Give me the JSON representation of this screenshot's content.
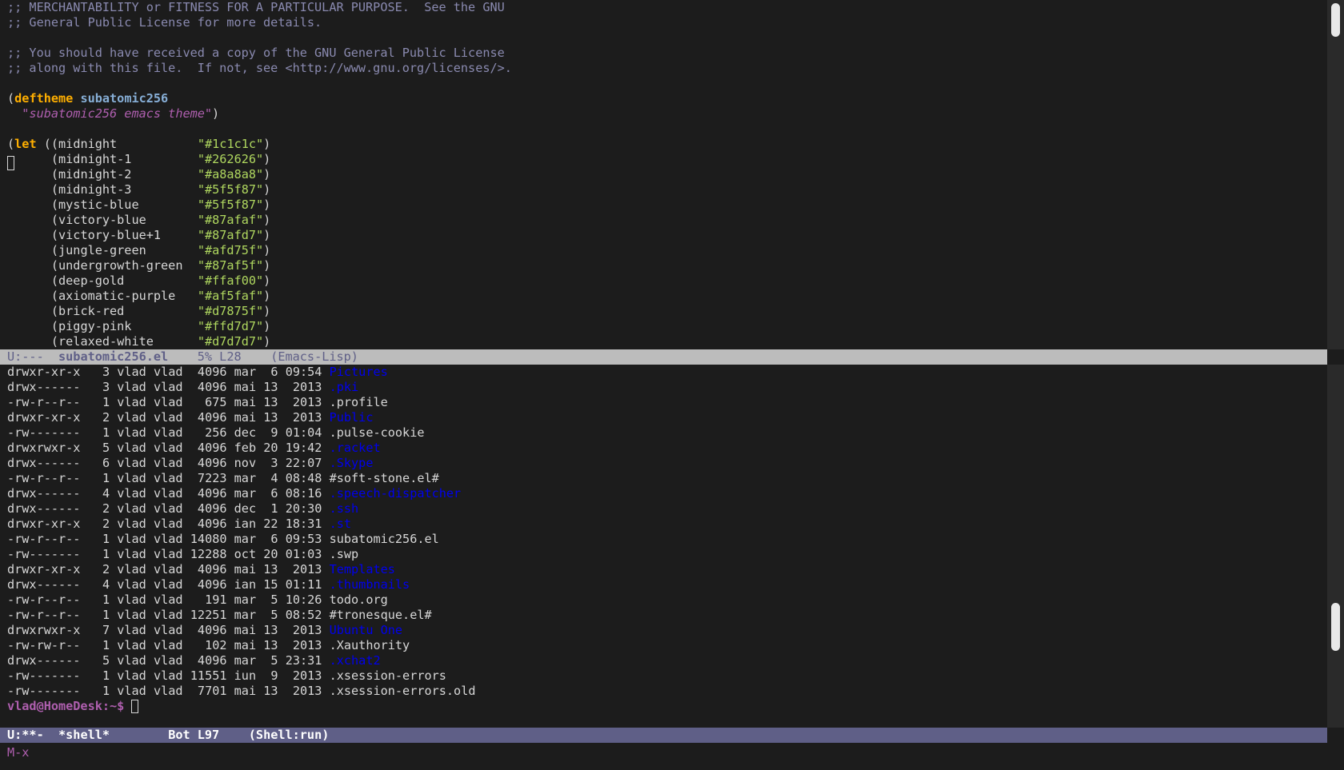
{
  "top_buffer": {
    "comment_lines": [
      ";; MERCHANTABILITY or FITNESS FOR A PARTICULAR PURPOSE.  See the GNU",
      ";; General Public License for more details.",
      "",
      ";; You should have received a copy of the GNU General Public License",
      ";; along with this file.  If not, see <http://www.gnu.org/licenses/>."
    ],
    "deftheme_keyword": "deftheme",
    "theme_name": "subatomic256",
    "theme_doc": "\"subatomic256 emacs theme\"",
    "let_keyword": "let",
    "colors": [
      {
        "name": "midnight",
        "value": "\"#1c1c1c\""
      },
      {
        "name": "midnight-1",
        "value": "\"#262626\""
      },
      {
        "name": "midnight-2",
        "value": "\"#a8a8a8\""
      },
      {
        "name": "midnight-3",
        "value": "\"#5f5f87\""
      },
      {
        "name": "mystic-blue",
        "value": "\"#5f5f87\""
      },
      {
        "name": "victory-blue",
        "value": "\"#87afaf\""
      },
      {
        "name": "victory-blue+1",
        "value": "\"#87afd7\""
      },
      {
        "name": "jungle-green",
        "value": "\"#afd75f\""
      },
      {
        "name": "undergrowth-green",
        "value": "\"#87af5f\""
      },
      {
        "name": "deep-gold",
        "value": "\"#ffaf00\""
      },
      {
        "name": "axiomatic-purple",
        "value": "\"#af5faf\""
      },
      {
        "name": "brick-red",
        "value": "\"#d7875f\""
      },
      {
        "name": "piggy-pink",
        "value": "\"#ffd7d7\""
      },
      {
        "name": "relaxed-white",
        "value": "\"#d7d7d7\""
      }
    ]
  },
  "modeline_top": {
    "status": "U:---",
    "buffer": "subatomic256.el",
    "position": "5% L28",
    "mode": "(Emacs-Lisp)"
  },
  "shell": {
    "rows": [
      {
        "perms": "drwxr-xr-x",
        "links": "3",
        "size": "4096",
        "month": "mar",
        "day": "6",
        "time": "09:54",
        "name": "Pictures",
        "dir": true
      },
      {
        "perms": "drwx------",
        "links": "3",
        "size": "4096",
        "month": "mai",
        "day": "13",
        "time": "2013",
        "name": ".pki",
        "dir": true
      },
      {
        "perms": "-rw-r--r--",
        "links": "1",
        "size": "675",
        "month": "mai",
        "day": "13",
        "time": "2013",
        "name": ".profile",
        "dir": false
      },
      {
        "perms": "drwxr-xr-x",
        "links": "2",
        "size": "4096",
        "month": "mai",
        "day": "13",
        "time": "2013",
        "name": "Public",
        "dir": true
      },
      {
        "perms": "-rw-------",
        "links": "1",
        "size": "256",
        "month": "dec",
        "day": "9",
        "time": "01:04",
        "name": ".pulse-cookie",
        "dir": false
      },
      {
        "perms": "drwxrwxr-x",
        "links": "5",
        "size": "4096",
        "month": "feb",
        "day": "20",
        "time": "19:42",
        "name": ".racket",
        "dir": true
      },
      {
        "perms": "drwx------",
        "links": "6",
        "size": "4096",
        "month": "nov",
        "day": "3",
        "time": "22:07",
        "name": ".Skype",
        "dir": true
      },
      {
        "perms": "-rw-r--r--",
        "links": "1",
        "size": "7223",
        "month": "mar",
        "day": "4",
        "time": "08:48",
        "name": "#soft-stone.el#",
        "dir": false
      },
      {
        "perms": "drwx------",
        "links": "4",
        "size": "4096",
        "month": "mar",
        "day": "6",
        "time": "08:16",
        "name": ".speech-dispatcher",
        "dir": true
      },
      {
        "perms": "drwx------",
        "links": "2",
        "size": "4096",
        "month": "dec",
        "day": "1",
        "time": "20:30",
        "name": ".ssh",
        "dir": true
      },
      {
        "perms": "drwxr-xr-x",
        "links": "2",
        "size": "4096",
        "month": "ian",
        "day": "22",
        "time": "18:31",
        "name": ".st",
        "dir": true
      },
      {
        "perms": "-rw-r--r--",
        "links": "1",
        "size": "14080",
        "month": "mar",
        "day": "6",
        "time": "09:53",
        "name": "subatomic256.el",
        "dir": false
      },
      {
        "perms": "-rw-------",
        "links": "1",
        "size": "12288",
        "month": "oct",
        "day": "20",
        "time": "01:03",
        "name": ".swp",
        "dir": false
      },
      {
        "perms": "drwxr-xr-x",
        "links": "2",
        "size": "4096",
        "month": "mai",
        "day": "13",
        "time": "2013",
        "name": "Templates",
        "dir": true
      },
      {
        "perms": "drwx------",
        "links": "4",
        "size": "4096",
        "month": "ian",
        "day": "15",
        "time": "01:11",
        "name": ".thumbnails",
        "dir": true
      },
      {
        "perms": "-rw-r--r--",
        "links": "1",
        "size": "191",
        "month": "mar",
        "day": "5",
        "time": "10:26",
        "name": "todo.org",
        "dir": false
      },
      {
        "perms": "-rw-r--r--",
        "links": "1",
        "size": "12251",
        "month": "mar",
        "day": "5",
        "time": "08:52",
        "name": "#tronesque.el#",
        "dir": false
      },
      {
        "perms": "drwxrwxr-x",
        "links": "7",
        "size": "4096",
        "month": "mai",
        "day": "13",
        "time": "2013",
        "name": "Ubuntu One",
        "dir": true
      },
      {
        "perms": "-rw-rw-r--",
        "links": "1",
        "size": "102",
        "month": "mai",
        "day": "13",
        "time": "2013",
        "name": ".Xauthority",
        "dir": false
      },
      {
        "perms": "drwx------",
        "links": "5",
        "size": "4096",
        "month": "mar",
        "day": "5",
        "time": "23:31",
        "name": ".xchat2",
        "dir": true
      },
      {
        "perms": "-rw-------",
        "links": "1",
        "size": "11551",
        "month": "iun",
        "day": "9",
        "time": "2013",
        "name": ".xsession-errors",
        "dir": false
      },
      {
        "perms": "-rw-------",
        "links": "1",
        "size": "7701",
        "month": "mai",
        "day": "13",
        "time": "2013",
        "name": ".xsession-errors.old",
        "dir": false
      }
    ],
    "owner": "vlad",
    "group": "vlad",
    "prompt": "vlad@HomeDesk:~$"
  },
  "modeline_bottom": {
    "status": "U:**-",
    "buffer": "*shell*",
    "position": "Bot L97",
    "mode": "(Shell:run)"
  },
  "minibuffer": {
    "text": "M-x"
  },
  "colors": {
    "background": "#1c1c1c",
    "foreground": "#d7d7d7",
    "comment": "#8a8ab0",
    "keyword": "#ffaf00",
    "function": "#87afd7",
    "string": "#afd75f",
    "doc": "#af5faf",
    "directory": "#0000ee",
    "modeline_active": "#5f5f87",
    "modeline_inactive": "#bcbcbc"
  }
}
